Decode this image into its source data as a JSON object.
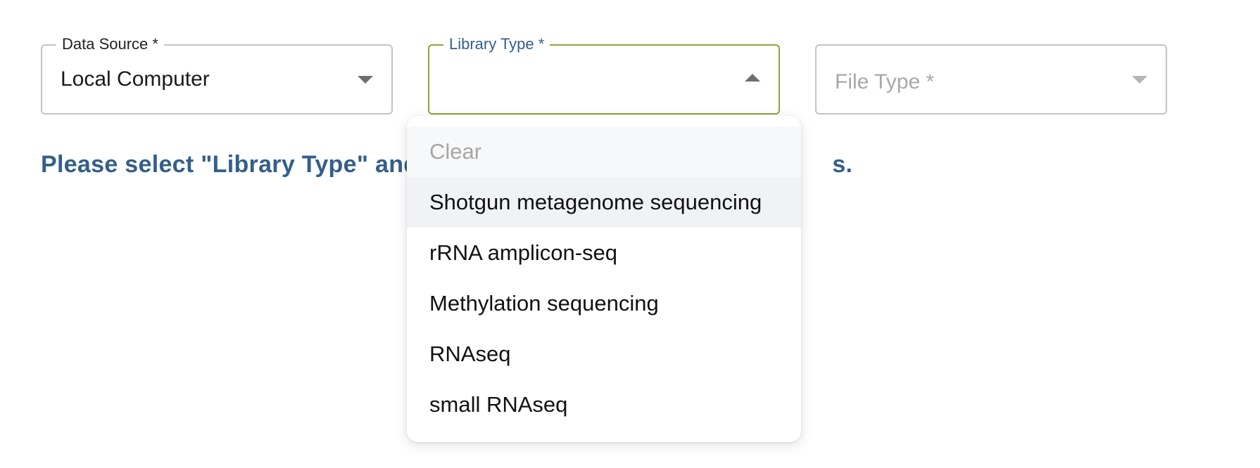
{
  "form": {
    "data_source": {
      "label": "Data Source *",
      "value": "Local Computer",
      "icon": "chevron-down-icon"
    },
    "library_type": {
      "label": "Library Type *",
      "value": "",
      "icon": "chevron-up-icon",
      "state": "open",
      "accent_color": "#8fa33b"
    },
    "file_type": {
      "placeholder": "File Type *",
      "icon": "chevron-down-icon",
      "state": "disabled"
    }
  },
  "hint": {
    "text_before_overlay": "Please select \"Library Type\" and",
    "text_after_overlay": "s."
  },
  "dropdown": {
    "clear_label": "Clear",
    "options": [
      "Shotgun metagenome sequencing",
      "rRNA amplicon-seq",
      "Methylation sequencing",
      "RNAseq",
      "small RNAseq"
    ],
    "hovered_index": 0
  },
  "colors": {
    "label_blue": "#335f8a",
    "focus_border": "#8fa33b"
  }
}
